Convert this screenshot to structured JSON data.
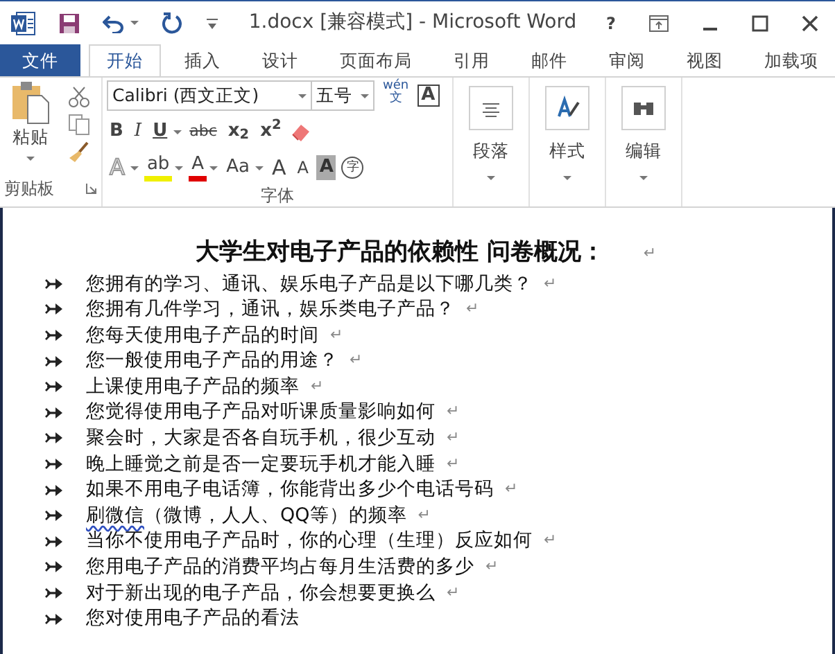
{
  "window": {
    "title": "1.docx [兼容模式] - Microsoft Word",
    "help": "?"
  },
  "tabs": [
    {
      "label": "文件",
      "kind": "file",
      "selected": false
    },
    {
      "label": "开始",
      "kind": "tab",
      "selected": true
    },
    {
      "label": "插入",
      "kind": "tab",
      "selected": false
    },
    {
      "label": "设计",
      "kind": "tab",
      "selected": false
    },
    {
      "label": "页面布局",
      "kind": "tab",
      "selected": false
    },
    {
      "label": "引用",
      "kind": "tab",
      "selected": false
    },
    {
      "label": "邮件",
      "kind": "tab",
      "selected": false
    },
    {
      "label": "审阅",
      "kind": "tab",
      "selected": false
    },
    {
      "label": "视图",
      "kind": "tab",
      "selected": false
    },
    {
      "label": "加载项",
      "kind": "tab",
      "selected": false
    }
  ],
  "clipboard": {
    "paste_label": "粘贴",
    "group_label": "剪贴板"
  },
  "font": {
    "font_name": "Calibri (西文正文)",
    "font_size": "五号",
    "phonetic_top": "wén",
    "phonetic_bottom": "文",
    "border_label": "A",
    "group_label": "字体",
    "row1": [
      {
        "kind": "bold",
        "label": "B"
      },
      {
        "kind": "italic",
        "label": "I"
      },
      {
        "kind": "underline",
        "label": "U"
      },
      {
        "kind": "strike",
        "label": "abc"
      },
      {
        "kind": "script",
        "label": "x$_{2}$"
      },
      {
        "kind": "script",
        "label": "x$^{2}$"
      },
      {
        "kind": "eraser"
      }
    ],
    "row2": [
      {
        "kind": "effects",
        "label": "A"
      },
      {
        "kind": "colored",
        "label": "ab",
        "color": "#f0f000"
      },
      {
        "kind": "colored",
        "label": "A",
        "color": "#e00000"
      },
      {
        "kind": "case",
        "label": "Aa"
      },
      {
        "kind": "grow",
        "label": "A"
      },
      {
        "kind": "shrink",
        "label": "A"
      },
      {
        "kind": "shade",
        "label": "A"
      },
      {
        "kind": "enclose",
        "label": "字"
      }
    ]
  },
  "big_buttons": [
    {
      "label": "段落",
      "kind": "paragraph"
    },
    {
      "label": "样式",
      "kind": "styles"
    },
    {
      "label": "编辑",
      "kind": "editing"
    }
  ],
  "document": {
    "heading": "大学生对电子产品的依赖性 问卷概况：",
    "heading_mark": "↵",
    "items": [
      {
        "parts": [
          {
            "text": "您拥有的学习、通讯、娱乐电子产品是以下哪几类？",
            "flagged": false
          }
        ],
        "mark": "↵"
      },
      {
        "parts": [
          {
            "text": "您拥有几件学习，通讯，娱乐类电子产品？",
            "flagged": false
          }
        ],
        "mark": "↵"
      },
      {
        "parts": [
          {
            "text": "您每天使用电子产品的时间",
            "flagged": false
          }
        ],
        "mark": "↵"
      },
      {
        "parts": [
          {
            "text": "您一般使用电子产品的用途？",
            "flagged": false
          }
        ],
        "mark": "↵"
      },
      {
        "parts": [
          {
            "text": "上课使用电子产品的频率",
            "flagged": false
          }
        ],
        "mark": "↵"
      },
      {
        "parts": [
          {
            "text": "您觉得使用电子产品对听课质量影响如何",
            "flagged": false
          }
        ],
        "mark": "↵"
      },
      {
        "parts": [
          {
            "text": "聚会时，大家是否各自玩手机，很少互动",
            "flagged": false
          }
        ],
        "mark": "↵"
      },
      {
        "parts": [
          {
            "text": "晚上睡觉之前是否一定要玩手机才能入睡",
            "flagged": false
          }
        ],
        "mark": "↵"
      },
      {
        "parts": [
          {
            "text": "如果不用电子电话簿，你能背出多少个电话号码",
            "flagged": false
          }
        ],
        "mark": "↵"
      },
      {
        "parts": [
          {
            "text": "刷微信",
            "flagged": true
          },
          {
            "text": "（微博，人人、QQ等）的频率",
            "flagged": false
          }
        ],
        "mark": "↵"
      },
      {
        "parts": [
          {
            "text": "当你不使用电子产品时，你的心理（生理）反应如何",
            "flagged": false
          }
        ],
        "mark": "↵"
      },
      {
        "parts": [
          {
            "text": "您用电子产品的消费平均占每月生活费的多少",
            "flagged": false
          }
        ],
        "mark": "↵"
      },
      {
        "parts": [
          {
            "text": "对于新出现的电子产品，你会想要更换么",
            "flagged": false
          }
        ],
        "mark": "↵"
      },
      {
        "parts": [
          {
            "text": "您对使用电子产品的看法",
            "flagged": false
          }
        ]
      }
    ]
  }
}
